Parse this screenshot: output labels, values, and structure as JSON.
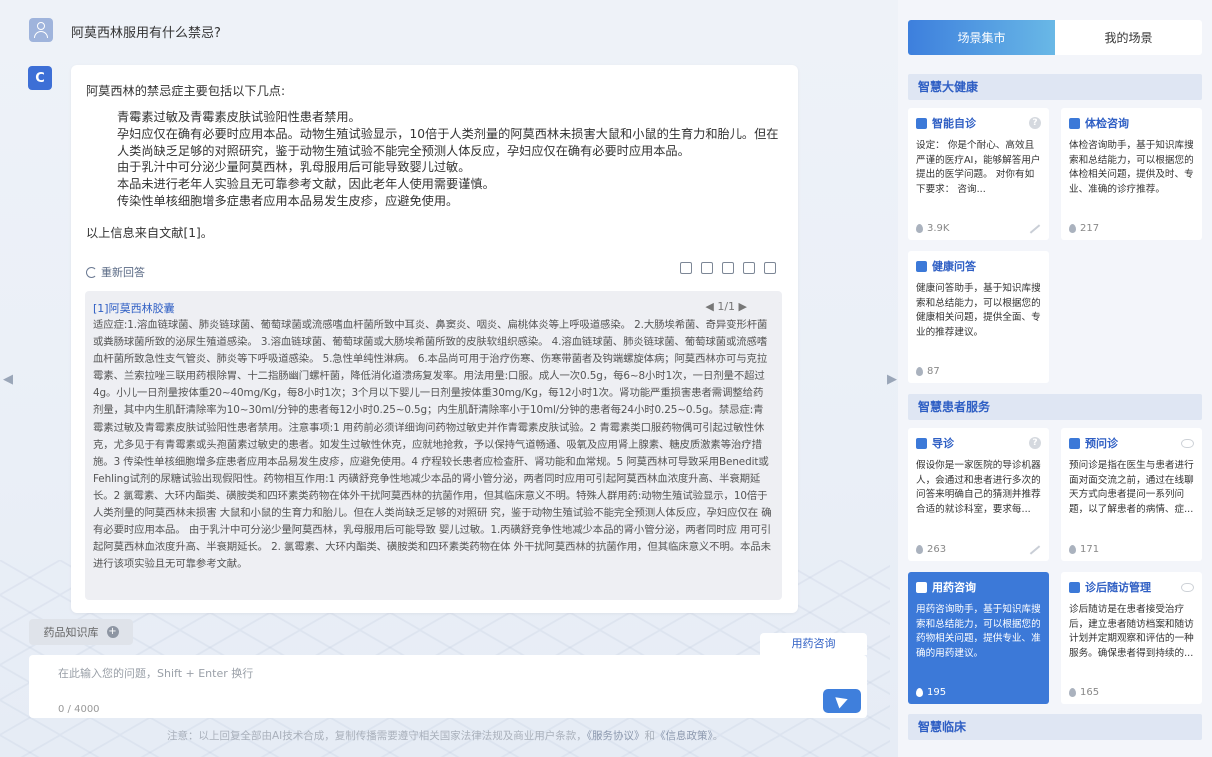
{
  "chat": {
    "question": "阿莫西林服用有什么禁忌?",
    "answer_avatar": "C",
    "answer_intro": "阿莫西林的禁忌症主要包括以下几点:",
    "answer_points": [
      "青霉素过敏及青霉素皮肤试验阳性患者禁用。",
      "孕妇应仅在确有必要时应用本品。动物生殖试验显示，10倍于人类剂量的阿莫西林未损害大鼠和小鼠的生育力和胎儿。但在人类尚缺乏足够的对照研究，鉴于动物生殖试验不能完全预测人体反应，孕妇应仅在确有必要时应用本品。",
      "由于乳汁中可分泌少量阿莫西林，乳母服用后可能导致婴儿过敏。",
      "本品未进行老年人实验且无可靠参考文献，因此老年人使用需要谨慎。",
      "传染性单核细胞增多症患者应用本品易发生皮疹，应避免使用。"
    ],
    "answer_source": "以上信息来自文献[1]。",
    "regenerate_label": "重新回答",
    "reference": {
      "title": "[1]阿莫西林胶囊",
      "pager": "◀ 1/1 ▶",
      "body": "适应症:1.溶血链球菌、肺炎链球菌、葡萄球菌或流感嗜血杆菌所致中耳炎、鼻窦炎、咽炎、扁桃体炎等上呼吸道感染。 2.大肠埃希菌、奇异变形杆菌或粪肠球菌所致的泌尿生殖道感染。 3.溶血链球菌、葡萄球菌或大肠埃希菌所致的皮肤软组织感染。 4.溶血链球菌、肺炎链球菌、葡萄球菌或流感嗜血杆菌所致急性支气管炎、肺炎等下呼吸道感染。 5.急性单纯性淋病。 6.本品尚可用于治疗伤寒、伤寒带菌者及钩端螺旋体病；阿莫西林亦可与克拉霉素、兰索拉唑三联用药根除胃、十二指肠幽门螺杆菌，降低消化道溃疡复发率。用法用量:口服。成人一次0.5g，每6~8小时1次，一日剂量不超过4g。小儿一日剂量按体重20~40mg/Kg，每8小时1次；3个月以下婴儿一日剂量按体重30mg/Kg，每12小时1次。肾功能严重损害患者需调整给药剂量，其中内生肌酐清除率为10~30ml/分钟的患者每12小时0.25~0.5g；内生肌酐清除率小于10ml/分钟的患者每24小时0.25~0.5g。禁忌症:青霉素过敏及青霉素皮肤试验阳性患者禁用。注意事项:1 用药前必须详细询问药物过敏史并作青霉素皮肤试验。2 青霉素类口服药物偶可引起过敏性休克，尤多见于有青霉素或头孢菌素过敏史的患者。如发生过敏性休克，应就地抢救，予以保持气道畅通、吸氧及应用肾上腺素、糖皮质激素等治疗措施。3 传染性单核细胞增多症患者应用本品易发生皮疹，应避免使用。4 疗程较长患者应检查肝、肾功能和血常规。5 阿莫西林可导致采用Benedit或Fehling试剂的尿糖试验出现假阳性。药物相互作用:1 丙磺舒竞争性地减少本品的肾小管分泌，两者同时应用可引起阿莫西林血浓度升高、半衰期延长。2 氯霉素、大环内酯类、磺胺类和四环素类药物在体外干扰阿莫西林的抗菌作用，但其临床意义不明。特殊人群用药:动物生殖试验显示，10倍于人类剂量的阿莫西林未损害 大鼠和小鼠的生育力和胎儿。但在人类尚缺乏足够的对照研 究，鉴于动物生殖试验不能完全预测人体反应，孕妇应仅在 确有必要时应用本品。 由于乳汁中可分泌少量阿莫西林，乳母服用后可能导致 婴儿过敏。1.丙磺舒竞争性地减少本品的肾小管分泌，两者同时应 用可引起阿莫西林血浓度升高、半衰期延长。 2. 氯霉素、大环内酯类、磺胺类和四环素类药物在体 外干扰阿莫西林的抗菌作用，但其临床意义不明。本品未进行该项实验且无可靠参考文献。"
    }
  },
  "composer": {
    "kb_tab_label": "药品知识库",
    "kb_plus": "+",
    "scene_tag": "用药咨询",
    "placeholder": "在此输入您的问题，Shift + Enter 换行",
    "char_count": "0 / 4000",
    "disclaimer_prefix": "注意：以上回复全部由AI技术合成，复制传播需要遵守相关国家法律法规及商业用户条款，",
    "disclaimer_link1": "《服务协议》",
    "disclaimer_mid": "和",
    "disclaimer_link2": "《信息政策》",
    "disclaimer_suffix": "。"
  },
  "panel": {
    "tab_market": "场景集市",
    "tab_mine": "我的场景",
    "sections": {
      "health": "智慧大健康",
      "patient": "智慧患者服务",
      "clinical": "智慧临床"
    },
    "cards": {
      "self_diag": {
        "title": "智能自诊",
        "desc": "设定： 你是个耐心、高效且严谨的医疗AI，能够解答用户提出的医学问题。 对你有如下要求： 咨询...",
        "count": "3.9K"
      },
      "checkup": {
        "title": "体检咨询",
        "desc": "体检咨询助手，基于知识库搜索和总结能力，可以根据您的体检相关问题，提供及时、专业、准确的诊疗推荐。",
        "count": "217"
      },
      "health_qa": {
        "title": "健康问答",
        "desc": "健康问答助手，基于知识库搜索和总结能力，可以根据您的健康相关问题，提供全面、专业的推荐建议。",
        "count": "87"
      },
      "guide": {
        "title": "导诊",
        "desc": "假设你是一家医院的导诊机器人，会通过和患者进行多次的问答来明确自己的猜测并推荐合适的就诊科室，要求每...",
        "count": "263"
      },
      "pre_consult": {
        "title": "预问诊",
        "desc": "预问诊是指在医生与患者进行面对面交流之前，通过在线聊天方式向患者提问一系列问题，以了解患者的病情、症...",
        "count": "171"
      },
      "medication": {
        "title": "用药咨询",
        "desc": "用药咨询助手，基于知识库搜索和总结能力，可以根据您的药物相关问题，提供专业、准确的用药建议。",
        "count": "195"
      },
      "followup": {
        "title": "诊后随访管理",
        "desc": "诊后随访是在患者接受治疗后，建立患者随访档案和随访计划并定期观察和评估的一种服务。确保患者得到持续的...",
        "count": "165"
      }
    },
    "help_badge": "?"
  }
}
